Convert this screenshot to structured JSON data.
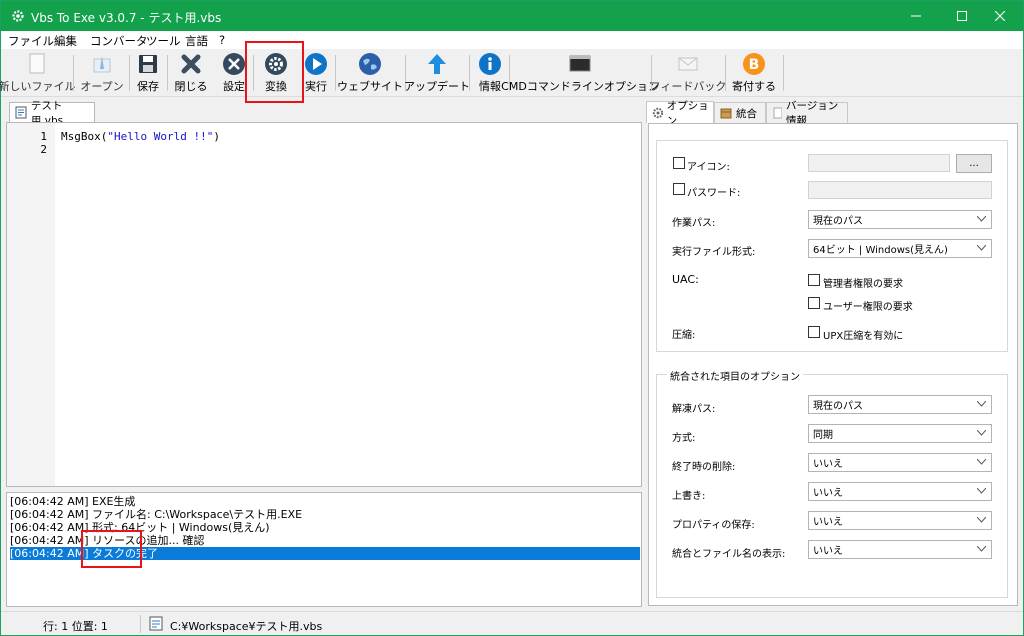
{
  "window": {
    "title": "Vbs To Exe v3.0.7 - テスト用.vbs",
    "accent_color": "#13a14c",
    "controls": [
      "minimize-icon",
      "maximize-icon",
      "close-icon"
    ]
  },
  "menu": {
    "items": [
      "ファイル",
      "編集",
      "コンバータ",
      "ツール",
      "言語",
      "?"
    ]
  },
  "toolbar": {
    "buttons": [
      {
        "label": "新しいファイル",
        "icon": "new-file-icon"
      },
      {
        "label": "オープン",
        "icon": "open-icon"
      },
      {
        "label": "保存",
        "icon": "save-icon"
      },
      {
        "label": "閉じる",
        "icon": "close-file-icon"
      },
      {
        "label": "設定",
        "icon": "settings-icon"
      },
      {
        "label": "変換",
        "icon": "convert-gear-icon"
      },
      {
        "label": "実行",
        "icon": "run-icon"
      },
      {
        "label": "ウェブサイト",
        "icon": "globe-icon"
      },
      {
        "label": "アップデート",
        "icon": "update-arrow-icon"
      },
      {
        "label": "情報",
        "icon": "info-icon"
      },
      {
        "label": "CMDコマンドラインオプション",
        "icon": "terminal-icon"
      },
      {
        "label": "フィードバック",
        "icon": "mail-icon"
      },
      {
        "label": "寄付する",
        "icon": "bitcoin-icon"
      }
    ],
    "highlight_color": "#e8141b"
  },
  "editor": {
    "tab_label": "テスト用.vbs",
    "line_numbers": [
      "1",
      "2"
    ],
    "code_keyword": "MsgBox(",
    "code_string": "\"Hello World !!\"",
    "code_end": ")"
  },
  "log": {
    "lines": [
      "[06:04:42 AM] EXE生成",
      "[06:04:42 AM] ファイル名: C:\\Workspace\\テスト用.EXE",
      "[06:04:42 AM] 形式: 64ビット | Windows(見えん)",
      "[06:04:42 AM] リソースの追加... 確認",
      "[06:04:42 AM] タスクの完了"
    ],
    "selected_index": 4,
    "selected_color": "#0a7bd8"
  },
  "options_panel": {
    "tabs": [
      "オプション",
      "統合",
      "バージョン情報"
    ],
    "active_tab": 0,
    "icon_label": "アイコン:",
    "icon_browse": "...",
    "password_label": "パスワード:",
    "workdir_label": "作業パス:",
    "workdir_value": "現在のパス",
    "exe_format_label": "実行ファイル形式:",
    "exe_format_value": "64ビット | Windows(見えん)",
    "uac_label": "UAC:",
    "uac_admin": "管理者権限の要求",
    "uac_user": "ユーザー権限の要求",
    "compress_label": "圧縮:",
    "compress_upx": "UPX圧縮を有効に",
    "embedded_group_title": "統合された項目のオプション",
    "extract_path_label": "解凍パス:",
    "extract_path_value": "現在のパス",
    "method_label": "方式:",
    "method_value": "同期",
    "delete_on_exit_label": "終了時の削除:",
    "delete_on_exit_value": "いいえ",
    "overwrite_label": "上書き:",
    "overwrite_value": "いいえ",
    "keep_props_label": "プロパティの保存:",
    "keep_props_value": "いいえ",
    "show_name_label": "統合とファイル名の表示:",
    "show_name_value": "いいえ"
  },
  "status": {
    "position": "行: 1 位置: 1",
    "path": "C:¥Workspace¥テスト用.vbs"
  }
}
